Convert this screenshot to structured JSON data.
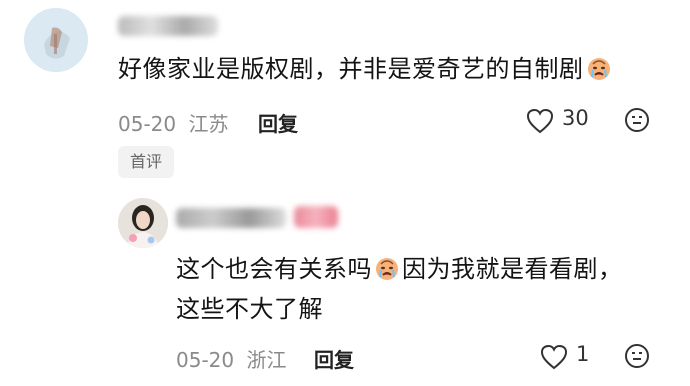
{
  "comment": {
    "text_before_emoji": "好像家业是版权剧，并非是爱奇艺的自制剧",
    "emoji_icon": "crying-face-icon",
    "date": "05-20",
    "location": "江苏",
    "reply_label": "回复",
    "like_count": "30",
    "badge": "首评"
  },
  "reply": {
    "line1_before_emoji": "这个也会有关系吗",
    "line1_after_emoji": "因为我就是看看剧，",
    "line2": "这些不大了解",
    "emoji_icon": "crying-face-icon",
    "date": "05-20",
    "location": "浙江",
    "reply_label": "回复",
    "like_count": "1"
  },
  "colors": {
    "text": "#141414",
    "meta": "#8a8a8a",
    "badge_bg": "#f2f2f2",
    "emoji": "#f4a06b"
  }
}
